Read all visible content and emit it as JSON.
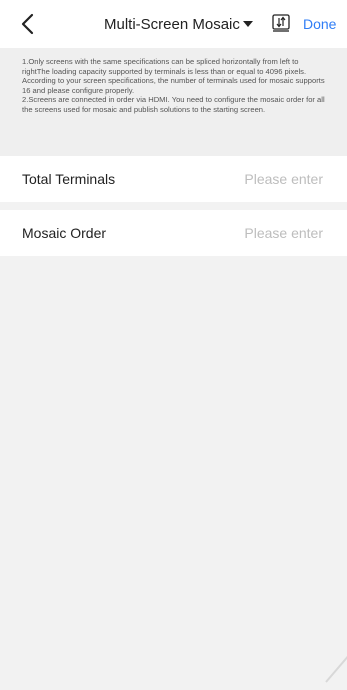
{
  "header": {
    "title": "Multi-Screen Mosaic",
    "done_label": "Done",
    "accent_color": "#2f7df6",
    "back_icon": "chevron-left-icon",
    "sort_icon": "sort-arrows-icon"
  },
  "notice": {
    "paragraphs": [
      "1.Only screens with the same specifications can be spliced horizontally from left to rightThe loading capacity supported by terminals is less than or equal to 4096 pixels. According to your screen specifications, the number of terminals used for mosaic supports 16 and please configure properly.",
      "2.Screens are connected in order via HDMI. You need to configure the mosaic order for all the screens used for mosaic and publish solutions to the starting screen."
    ]
  },
  "fields": {
    "total_terminals": {
      "label": "Total Terminals",
      "placeholder": "Please enter",
      "value": ""
    },
    "mosaic_order": {
      "label": "Mosaic Order",
      "placeholder": "Please enter",
      "value": ""
    }
  }
}
